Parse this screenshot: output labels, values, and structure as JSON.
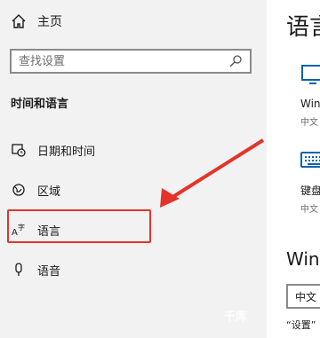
{
  "sidebar": {
    "home_label": "主页",
    "search_placeholder": "查找设置",
    "section_title": "时间和语言",
    "items": [
      {
        "label": "日期和时间",
        "icon": "date-time-icon"
      },
      {
        "label": "区域",
        "icon": "region-icon"
      },
      {
        "label": "语言",
        "icon": "language-icon",
        "highlighted": true
      },
      {
        "label": "语音",
        "icon": "microphone-icon"
      }
    ]
  },
  "main": {
    "title": "语言",
    "display_lang_label": "Win",
    "display_lang_sub": "中文",
    "keyboard_label": "键盘",
    "keyboard_sub": "中文",
    "section_heading": "Wind",
    "dropdown_value": "中文",
    "note": "“设置”"
  },
  "watermark": "千库",
  "colors": {
    "annotation_red": "#e5332a",
    "accent_blue": "#0063b1"
  }
}
